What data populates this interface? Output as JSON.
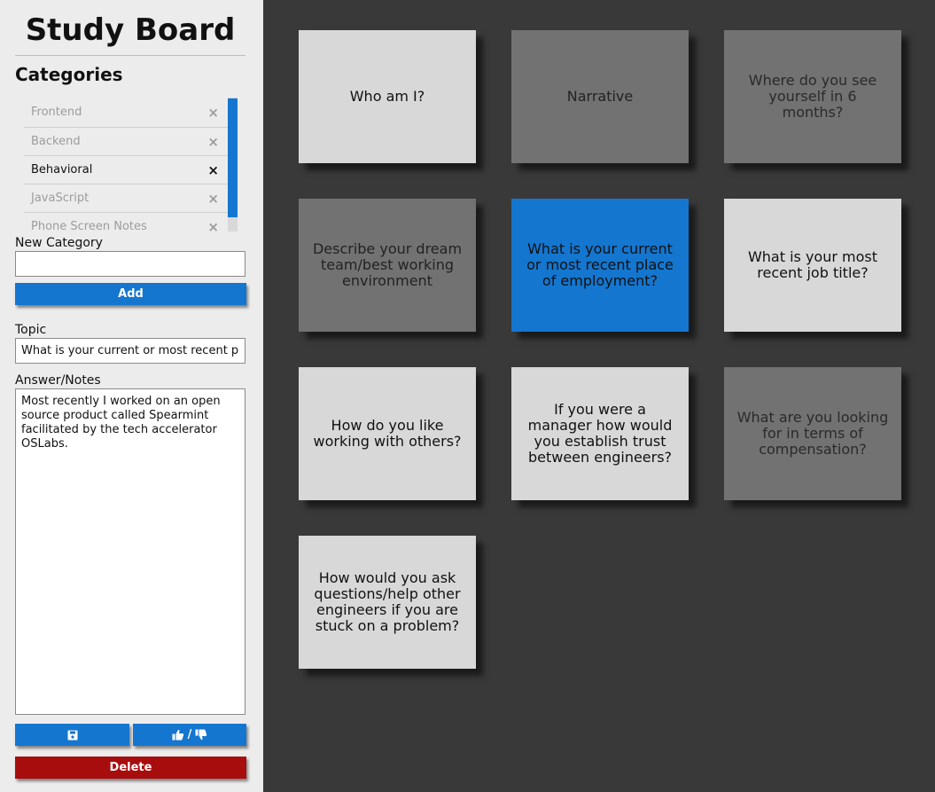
{
  "app_title": "Study Board",
  "categories_heading": "Categories",
  "categories": [
    {
      "label": "Frontend",
      "remove": "×",
      "active": false
    },
    {
      "label": "Backend",
      "remove": "×",
      "active": false
    },
    {
      "label": "Behavioral",
      "remove": "×",
      "active": true
    },
    {
      "label": "JavaScript",
      "remove": "×",
      "active": false
    },
    {
      "label": "Phone Screen Notes",
      "remove": "×",
      "active": false
    }
  ],
  "new_category": {
    "label": "New Category",
    "value": "",
    "add_button": "Add"
  },
  "topic": {
    "label": "Topic",
    "value": "What is your current or most recent pl"
  },
  "answer": {
    "label": "Answer/Notes",
    "value": "Most recently I worked on an open source product called Spearmint facilitated by the tech accelerator OSLabs."
  },
  "actions": {
    "save_icon": "floppy-disk-icon",
    "vote_separator": "/",
    "thumbs_up_icon": "thumbs-up-icon",
    "thumbs_down_icon": "thumbs-down-icon",
    "delete_label": "Delete"
  },
  "colors": {
    "accent": "#1476cf",
    "danger": "#a80d0d",
    "board_bg": "#393939",
    "card_light": "#d8d8d8",
    "card_dark": "#727272"
  },
  "cards": [
    {
      "text": "Who am I?",
      "tone": "light"
    },
    {
      "text": "Narrative",
      "tone": "dark"
    },
    {
      "text": "Where do you see yourself in 6 months?",
      "tone": "dark"
    },
    {
      "text": "Describe your dream team/best working environment",
      "tone": "dark"
    },
    {
      "text": "What is your current or most recent place of employment?",
      "tone": "selected"
    },
    {
      "text": "What is your most recent job title?",
      "tone": "light"
    },
    {
      "text": "How do you like working with others?",
      "tone": "light"
    },
    {
      "text": "If you were a manager how would you establish trust between engineers?",
      "tone": "light"
    },
    {
      "text": "What are you looking for in terms of compensation?",
      "tone": "dark"
    },
    {
      "text": "How would you ask questions/help other engineers if you are stuck on a problem?",
      "tone": "light"
    }
  ]
}
